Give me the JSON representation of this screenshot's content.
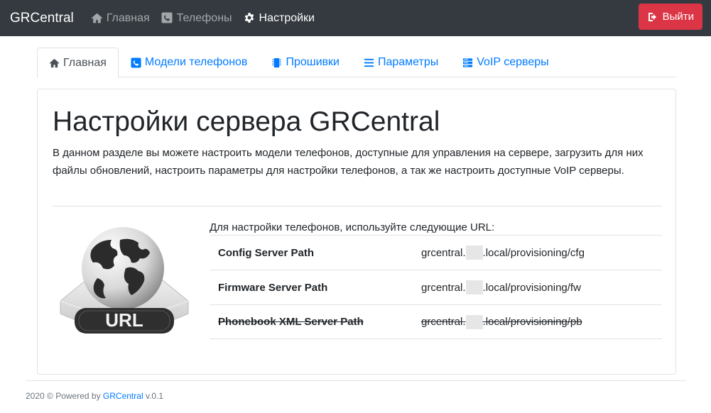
{
  "navbar": {
    "brand": "GRCentral",
    "links": [
      {
        "label": "Главная",
        "icon": "home-icon",
        "active": false
      },
      {
        "label": "Телефоны",
        "icon": "phone-square-icon",
        "active": false
      },
      {
        "label": "Настройки",
        "icon": "gear-icon",
        "active": true
      }
    ],
    "logout_label": "Выйти",
    "logout_icon": "sign-out-icon"
  },
  "tabs": [
    {
      "label": "Главная",
      "icon": "home-icon",
      "active": true
    },
    {
      "label": "Модели телефонов",
      "icon": "phone-square-icon",
      "active": false
    },
    {
      "label": "Прошивки",
      "icon": "microchip-icon",
      "active": false
    },
    {
      "label": "Параметры",
      "icon": "list-icon",
      "active": false
    },
    {
      "label": "VoIP серверы",
      "icon": "server-icon",
      "active": false
    }
  ],
  "main": {
    "title": "Настройки сервера GRCentral",
    "intro": "В данном разделе вы можете настроить модели телефонов, доступные для управления на сервере, загрузить для них файлы обновлений, настроить параметры для настройки телефонов, а так же настроить доступные VoIP серверы.",
    "image_label": "URL",
    "url_caption": "Для настройки телефонов, используйте следующие URL:",
    "urls": [
      {
        "name": "Config Server Path",
        "prefix": "grcentral.",
        "suffix": ".local/provisioning/cfg",
        "struck": false
      },
      {
        "name": "Firmware Server Path",
        "prefix": "grcentral.",
        "suffix": ".local/provisioning/fw",
        "struck": false
      },
      {
        "name": "Phonebook XML Server Path",
        "prefix": "grcentral.",
        "suffix": ".local/provisioning/pb",
        "struck": true
      }
    ]
  },
  "footer": {
    "prefix": "2020 © Powered by ",
    "link": "GRCentral",
    "version": " v.0.1"
  },
  "colors": {
    "navbar_bg": "#343a40",
    "logout_bg": "#dc3545",
    "link": "#007bff"
  }
}
